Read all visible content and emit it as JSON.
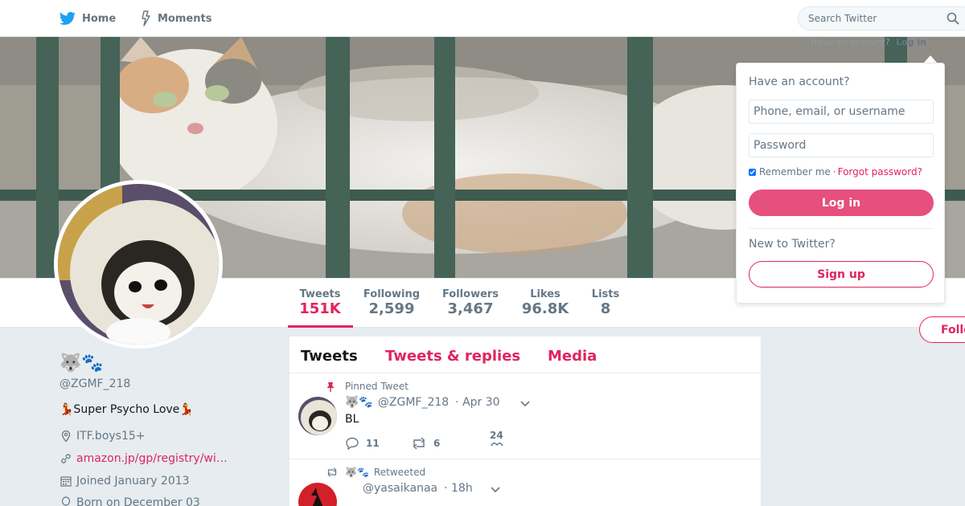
{
  "nav": {
    "home_label": "Home",
    "moments_label": "Moments",
    "search_placeholder": "Search Twitter",
    "have_account_hint": "Have an account?",
    "login_link": "Log in"
  },
  "profile_nav": {
    "stats": [
      {
        "label": "Tweets",
        "value": "151K"
      },
      {
        "label": "Following",
        "value": "2,599"
      },
      {
        "label": "Followers",
        "value": "3,467"
      },
      {
        "label": "Likes",
        "value": "96.8K"
      },
      {
        "label": "Lists",
        "value": "8"
      }
    ],
    "follow_label": "Follow"
  },
  "profile": {
    "name": "🐺🐾",
    "handle": "@ZGMF_218",
    "bio": "💃Super Psycho Love💃",
    "location": "ITF.boys15+",
    "url": "amazon.jp/gp/registry/wi…",
    "joined": "Joined January 2013",
    "born": "Born on December 03"
  },
  "timeline": {
    "tabs": [
      "Tweets",
      "Tweets & replies",
      "Media"
    ],
    "tweets": [
      {
        "context": "Pinned Tweet",
        "author_name": "🐺🐾",
        "handle": "@ZGMF_218",
        "time": "· Apr 30",
        "text": "BL",
        "replies": "11",
        "retweets": "6",
        "likes": "24"
      },
      {
        "context_name": "🐺🐾",
        "context": "Retweeted",
        "handle": "@yasaikanaa",
        "time": "· 18h"
      }
    ]
  },
  "login_panel": {
    "title": "Have an account?",
    "username_placeholder": "Phone, email, or username",
    "password_placeholder": "Password",
    "remember_label": "Remember me",
    "separator": "·",
    "forgot_label": "Forgot password?",
    "login_button": "Log in",
    "new_prompt": "New to Twitter?",
    "signup_button": "Sign up"
  },
  "colors": {
    "accent": "#e0245e",
    "twitter_blue": "#1da1f2",
    "page_bg": "#e6ecf0"
  }
}
